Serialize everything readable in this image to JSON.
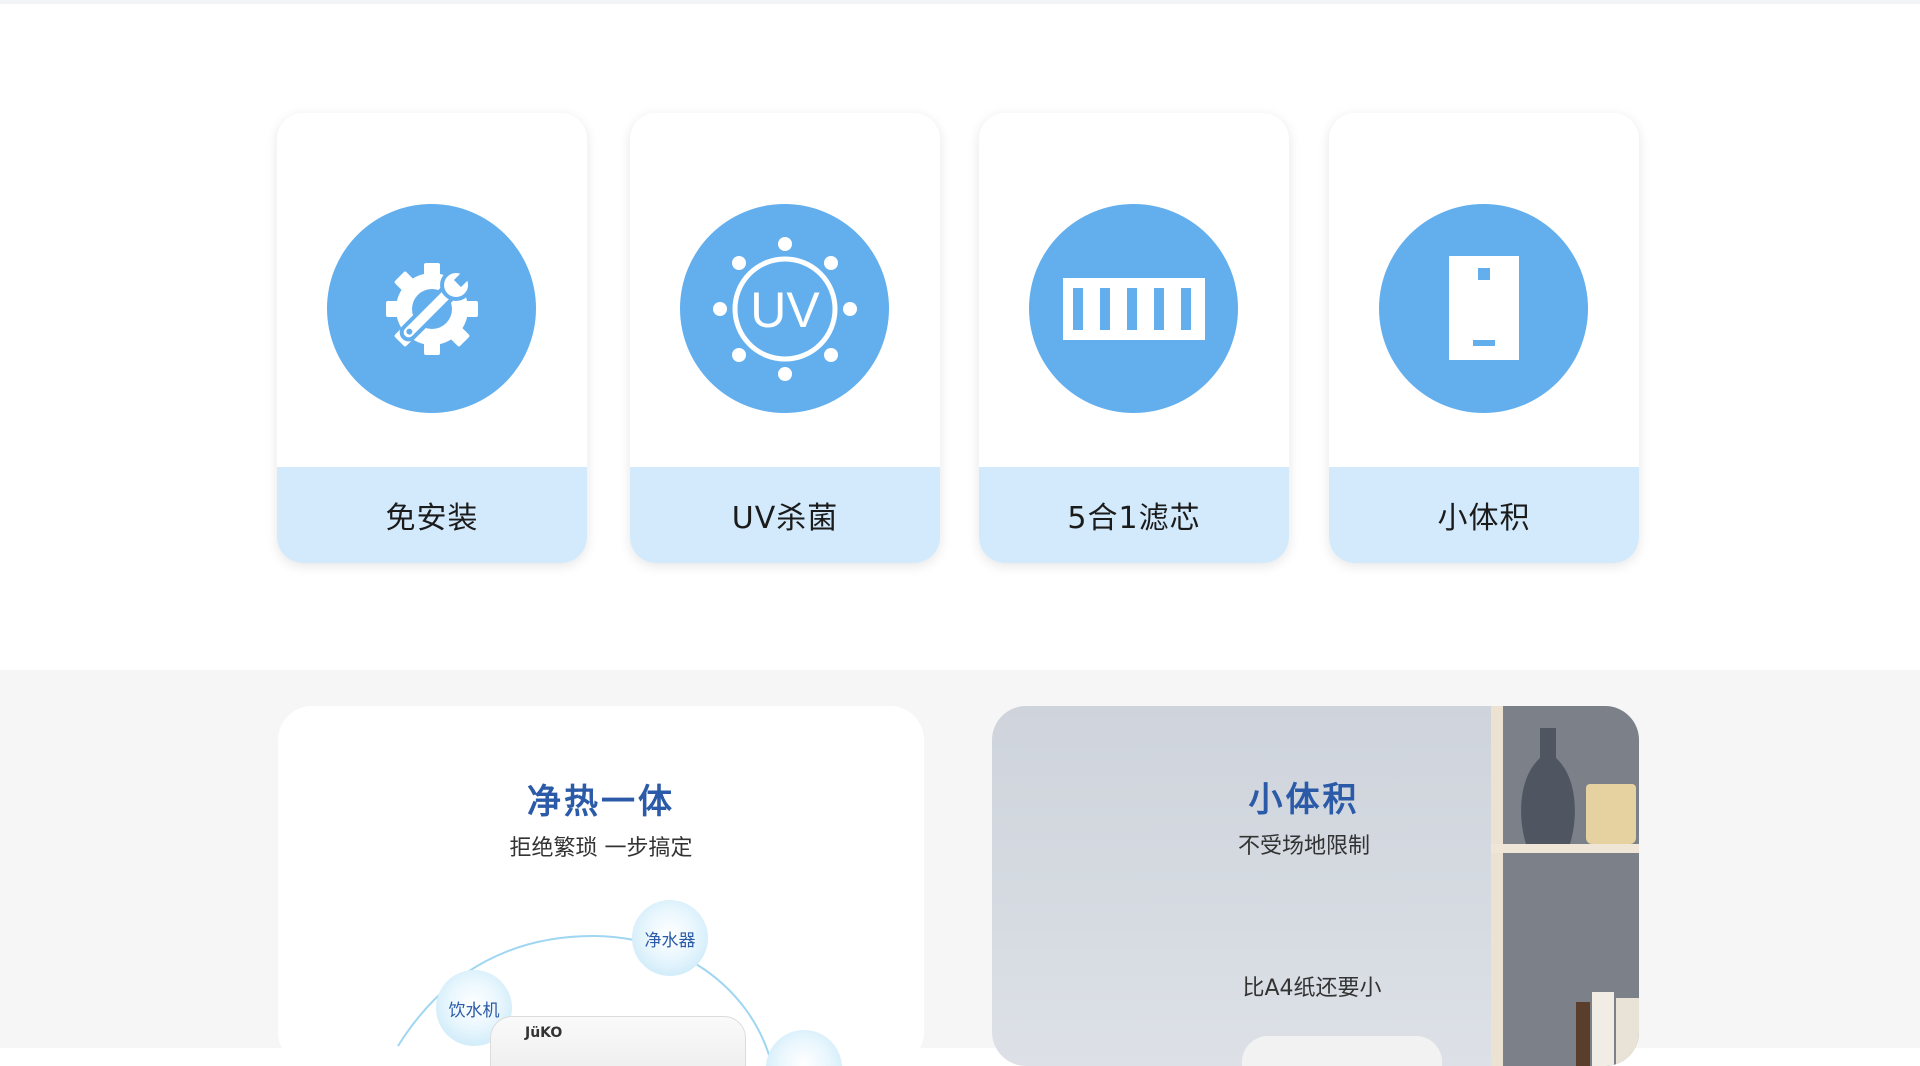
{
  "features": [
    {
      "label": "免安装",
      "icon": "wrench-gear-icon"
    },
    {
      "label": "UV杀菌",
      "icon": "uv-sun-icon",
      "icon_text": "UV"
    },
    {
      "label": "5合1滤芯",
      "icon": "filter-cartridge-icon"
    },
    {
      "label": "小体积",
      "icon": "phone-device-icon"
    }
  ],
  "panel_left": {
    "title": "净热一体",
    "subtitle": "拒绝繁琐 一步搞定",
    "bubbles": [
      "净水器",
      "饮水机"
    ],
    "brand": "JüKO"
  },
  "panel_right": {
    "title": "小体积",
    "subtitle": "不受场地限制",
    "note": "比A4纸还要小"
  },
  "colors": {
    "icon_circle": "#63afee",
    "label_strip": "#d2eafb",
    "title_blue": "#2a5aa8",
    "band_grey": "#f6f6f6"
  }
}
